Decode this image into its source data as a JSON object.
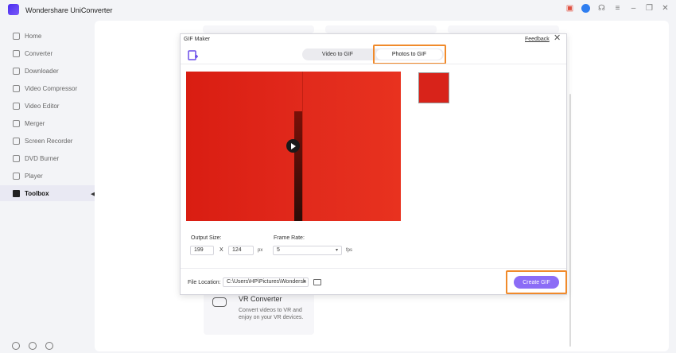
{
  "app": {
    "title": "Wondershare UniConverter"
  },
  "titlebar_icons": [
    "gift-icon",
    "user-avatar-icon",
    "headset-icon",
    "menu-icon",
    "minimize-icon",
    "restore-icon",
    "close-icon"
  ],
  "sidebar": {
    "items": [
      {
        "label": "Home",
        "icon": "home-icon",
        "active": false
      },
      {
        "label": "Converter",
        "icon": "converter-icon",
        "active": false
      },
      {
        "label": "Downloader",
        "icon": "downloader-icon",
        "active": false
      },
      {
        "label": "Video Compressor",
        "icon": "compress-icon",
        "active": false
      },
      {
        "label": "Video Editor",
        "icon": "scissors-icon",
        "active": false
      },
      {
        "label": "Merger",
        "icon": "merger-icon",
        "active": false
      },
      {
        "label": "Screen Recorder",
        "icon": "record-icon",
        "active": false
      },
      {
        "label": "DVD Burner",
        "icon": "disc-icon",
        "active": false
      },
      {
        "label": "Player",
        "icon": "player-icon",
        "active": false
      },
      {
        "label": "Toolbox",
        "icon": "grid-icon",
        "active": true
      }
    ]
  },
  "vr_card": {
    "title": "VR Converter",
    "description": "Convert videos to VR and enjoy on your VR devices."
  },
  "dialog": {
    "title": "GIF Maker",
    "feedback": "Feedback",
    "tabs": {
      "video_to_gif": "Video to GIF",
      "photos_to_gif": "Photos to GIF"
    },
    "active_tab": "Photos to GIF",
    "output_size": {
      "label": "Output Size:",
      "width": "199",
      "separator": "X",
      "height": "124",
      "unit": "px"
    },
    "frame_rate": {
      "label": "Frame Rate:",
      "value": "5",
      "unit": "fps"
    },
    "file_location": {
      "label": "File Location:",
      "path": "C:\\Users\\HP\\Pictures\\Wondersh"
    },
    "create_button": "Create GIF"
  },
  "colors": {
    "accent": "#8b6cf6",
    "highlight": "#f08a2b",
    "preview_red": "#e0271a"
  }
}
